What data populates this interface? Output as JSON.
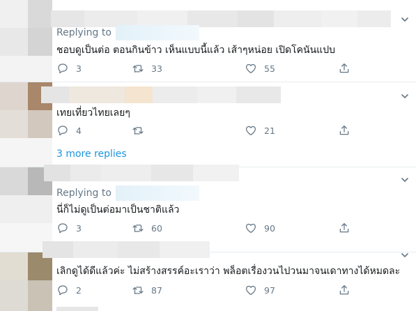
{
  "tweets": [
    {
      "replying_label": "Replying to",
      "text": "ชอบดูเป็นต่อ ตอนกินข้าว เห็นแบบนี้แล้ว เส้าๆหน่อย เปิดโคนันแปบ",
      "replies": "3",
      "retweets": "33",
      "likes": "55"
    },
    {
      "text": "เทยเที่ยวไทยเลยๆ",
      "replies": "4",
      "retweets": "",
      "likes": "21"
    },
    {
      "replying_label": "Replying to",
      "text": "นี่ก็ไม่ดูเป็นต่อมาเป็นชาติแล้ว",
      "replies": "3",
      "retweets": "60",
      "likes": "90"
    },
    {
      "text": "เลิกดูได้ดีแล้วค่ะ ไม่สร้างสรรค์อะเราว่า พล็อตเรื่องวนไปวนมาจนเดาทางได้หมดละ",
      "replies": "2",
      "retweets": "87",
      "likes": "97"
    }
  ],
  "more_replies": "3 more replies",
  "icons": {
    "reply": "reply-icon",
    "retweet": "retweet-icon",
    "like": "heart-icon",
    "share": "share-icon",
    "caret": "chevron-down-icon"
  },
  "colors": {
    "link": "#1b95e0",
    "muted": "#657786",
    "text": "#14171a",
    "divider": "#e6ecf0"
  }
}
